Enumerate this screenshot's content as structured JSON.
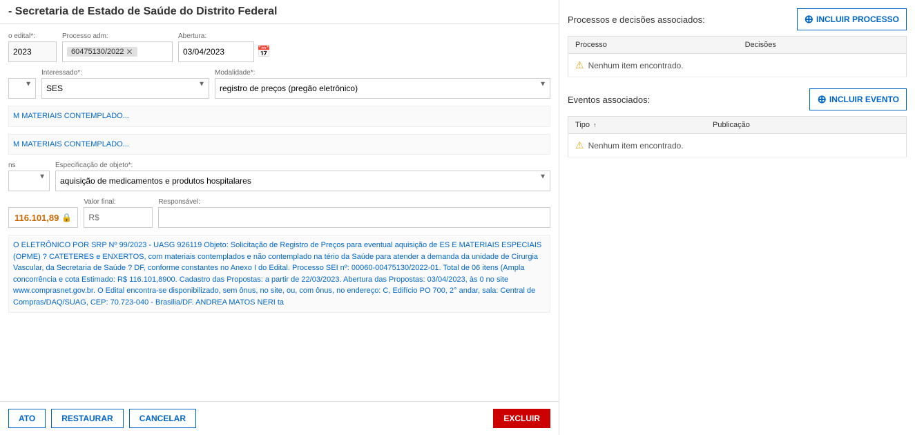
{
  "header": {
    "title": "- Secretaria de Estado de Saúde do Distrito Federal"
  },
  "form": {
    "ano_label": "o edital*:",
    "ano_value": "2023",
    "processo_adm_label": "Processo adm:",
    "processo_adm_value": "60475130/2022",
    "abertura_label": "Abertura:",
    "abertura_value": "03/04/2023",
    "interessado_label": "Interessado*:",
    "interessado_value": "SES",
    "modalidade_label": "Modalidade*:",
    "modalidade_value": "registro de preços (pregão eletrônico)",
    "objeto_label": "Especificação de objeto*:",
    "objeto_value": "aquisição de medicamentos e produtos hospitalares",
    "valor_label": "Valor final:",
    "valor_value": "116.101,89",
    "valor_currency": "R$",
    "responsavel_label": "Responsável:",
    "responsavel_value": "",
    "description_text1": "M MATERIAIS CONTEMPLADO...",
    "description_text2": "M MATERIAIS CONTEMPLADO...",
    "description_long": "O ELETRÔNICO POR SRP Nº 99/2023 - UASG 926119 Objeto: Solicitação de Registro de Preços para eventual aquisição de ES E MATERIAIS ESPECIAIS (OPME) ? CATETERES e ENXERTOS, com materiais contemplados e não contemplado na tério da Saúde para atender a demanda da unidade de Cirurgia Vascular, da Secretaria de Saúde ? DF, conforme constantes no Anexo I do Edital. Processo SEI nº: 00060-00475130/2022-01. Total de 06 itens (Ampla concorrência e cota Estimado: R$ 116.101,8900. Cadastro das Propostas: a partir de 22/03/2023. Abertura das Propostas: 03/04/2023, às 0 no site www.comprasnet.gov.br. O Edital encontra-se disponibilizado, sem ônus, no site, ou, com ônus, no endereço: C, Edifício PO 700, 2° andar, sala: Central de Compras/DAQ/SUAG, CEP: 70.723-040 - Brasilia/DF. ANDREA MATOS NERI ta"
  },
  "buttons": {
    "ato_label": "ATO",
    "restaurar_label": "RESTAURAR",
    "cancelar_label": "CANCELAR",
    "excluir_label": "EXCLUIR"
  },
  "right": {
    "processos_title": "Processos e decisões associados:",
    "incluir_processo_label": "INCLUIR PROCESSO",
    "processo_col": "Processo",
    "decisoes_col": "Decisões",
    "empty_processos": "Nenhum item encontrado.",
    "eventos_title": "Eventos associados:",
    "incluir_evento_label": "INCLUIR EVENTO",
    "tipo_col": "Tipo",
    "publicacao_col": "Publicação",
    "empty_eventos": "Nenhum item encontrado."
  }
}
